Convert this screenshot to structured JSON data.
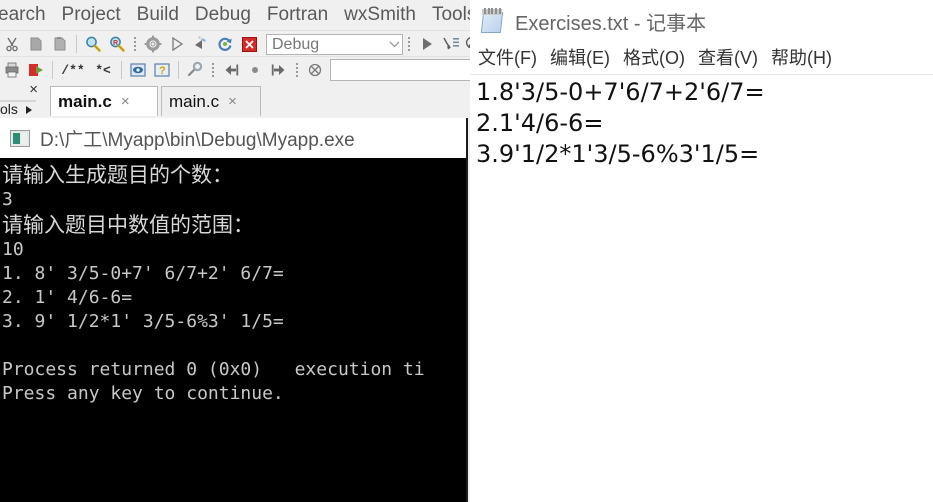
{
  "codeblocks": {
    "menubar": {
      "items": [
        {
          "label": "earch",
          "name": "menu-search"
        },
        {
          "label": "Project",
          "name": "menu-project"
        },
        {
          "label": "Build",
          "name": "menu-build"
        },
        {
          "label": "Debug",
          "name": "menu-debug"
        },
        {
          "label": "Fortran",
          "name": "menu-fortran"
        },
        {
          "label": "wxSmith",
          "name": "menu-wxsmith"
        },
        {
          "label": "Tools",
          "name": "menu-tools"
        }
      ]
    },
    "toolbar1": {
      "icons": [
        {
          "name": "cut-icon",
          "glyph": "✂"
        },
        {
          "name": "copy-icon",
          "glyph": "❑"
        },
        {
          "name": "paste-icon",
          "glyph": "❐"
        },
        {
          "name": "find-icon",
          "glyph": "ὐD"
        },
        {
          "name": "replace-icon",
          "glyph": "R"
        },
        {
          "name": "build-icon",
          "glyph": "⚙"
        },
        {
          "name": "run-icon",
          "glyph": "▶"
        },
        {
          "name": "build-and-run-icon",
          "glyph": "▶"
        },
        {
          "name": "rebuild-icon",
          "glyph": "♻"
        },
        {
          "name": "abort-icon",
          "glyph": "✕"
        }
      ],
      "target_combo": {
        "name": "build-target-combo",
        "value": "Debug"
      },
      "debug_icons": [
        {
          "name": "debug-continue-icon",
          "glyph": "▶"
        },
        {
          "name": "debug-step-into-icon",
          "glyph": "↳"
        },
        {
          "name": "debug-step-over-icon",
          "glyph": "↷"
        }
      ]
    },
    "toolbar2": {
      "icons": [
        {
          "name": "print-icon",
          "glyph": "⎙"
        },
        {
          "name": "run-to-cursor-icon",
          "glyph": "▶"
        },
        {
          "name": "comment-icon",
          "glyph": "/**"
        },
        {
          "name": "uncomment-icon",
          "glyph": "*<"
        },
        {
          "name": "doxygen-icon",
          "glyph": "ⓘ"
        },
        {
          "name": "help-icon",
          "glyph": "?"
        },
        {
          "name": "settings-icon",
          "glyph": "ὒ7"
        },
        {
          "name": "nav-back-icon",
          "glyph": "⇤"
        },
        {
          "name": "nav-bookmark-icon",
          "glyph": "●"
        },
        {
          "name": "nav-forward-icon",
          "glyph": "⇥"
        },
        {
          "name": "clear-bookmarks-icon",
          "glyph": "⊗"
        }
      ],
      "search_combo": {
        "name": "symbol-search-combo",
        "value": "",
        "placeholder": ""
      }
    },
    "left_panel": {
      "name": "management-panel",
      "tab_label": "ols",
      "close_label": "×"
    },
    "editor_tabs": [
      {
        "label": "main.c",
        "active": true,
        "close": "×"
      },
      {
        "label": "main.c",
        "active": false,
        "close": "×"
      }
    ]
  },
  "console": {
    "title": "D:\\广工\\Myapp\\bin\\Debug\\Myapp.exe",
    "lines": [
      {
        "text": "请输入生成题目的个数：",
        "cjk": true
      },
      {
        "text": "3",
        "cjk": false
      },
      {
        "text": "请输入题目中数值的范围：",
        "cjk": true
      },
      {
        "text": "10",
        "cjk": false
      },
      {
        "text": "1. 8' 3/5-0+7' 6/7+2' 6/7=",
        "cjk": false
      },
      {
        "text": "2. 1' 4/6-6=",
        "cjk": false
      },
      {
        "text": "3. 9' 1/2*1' 3/5-6%3' 1/5=",
        "cjk": false
      },
      {
        "text": "",
        "cjk": false
      },
      {
        "text": "Process returned 0 (0x0)   execution ti",
        "cjk": false
      },
      {
        "text": "Press any key to continue.",
        "cjk": false
      }
    ]
  },
  "notepad": {
    "title": "Exercises.txt - 记事本",
    "menubar": [
      {
        "label": "文件(F)",
        "name": "np-menu-file"
      },
      {
        "label": "编辑(E)",
        "name": "np-menu-edit"
      },
      {
        "label": "格式(O)",
        "name": "np-menu-format"
      },
      {
        "label": "查看(V)",
        "name": "np-menu-view"
      },
      {
        "label": "帮助(H)",
        "name": "np-menu-help"
      }
    ],
    "content_lines": [
      "1.8'3/5-0+7'6/7+2'6/7=",
      "2.1'4/6-6=",
      "3.9'1/2*1'3/5-6%3'1/5="
    ]
  },
  "colors": {
    "console_bg": "#000000",
    "console_fg": "#c8c8c8",
    "chrome_bg": "#f0f0f0",
    "notepad_bg": "#ffffff"
  }
}
